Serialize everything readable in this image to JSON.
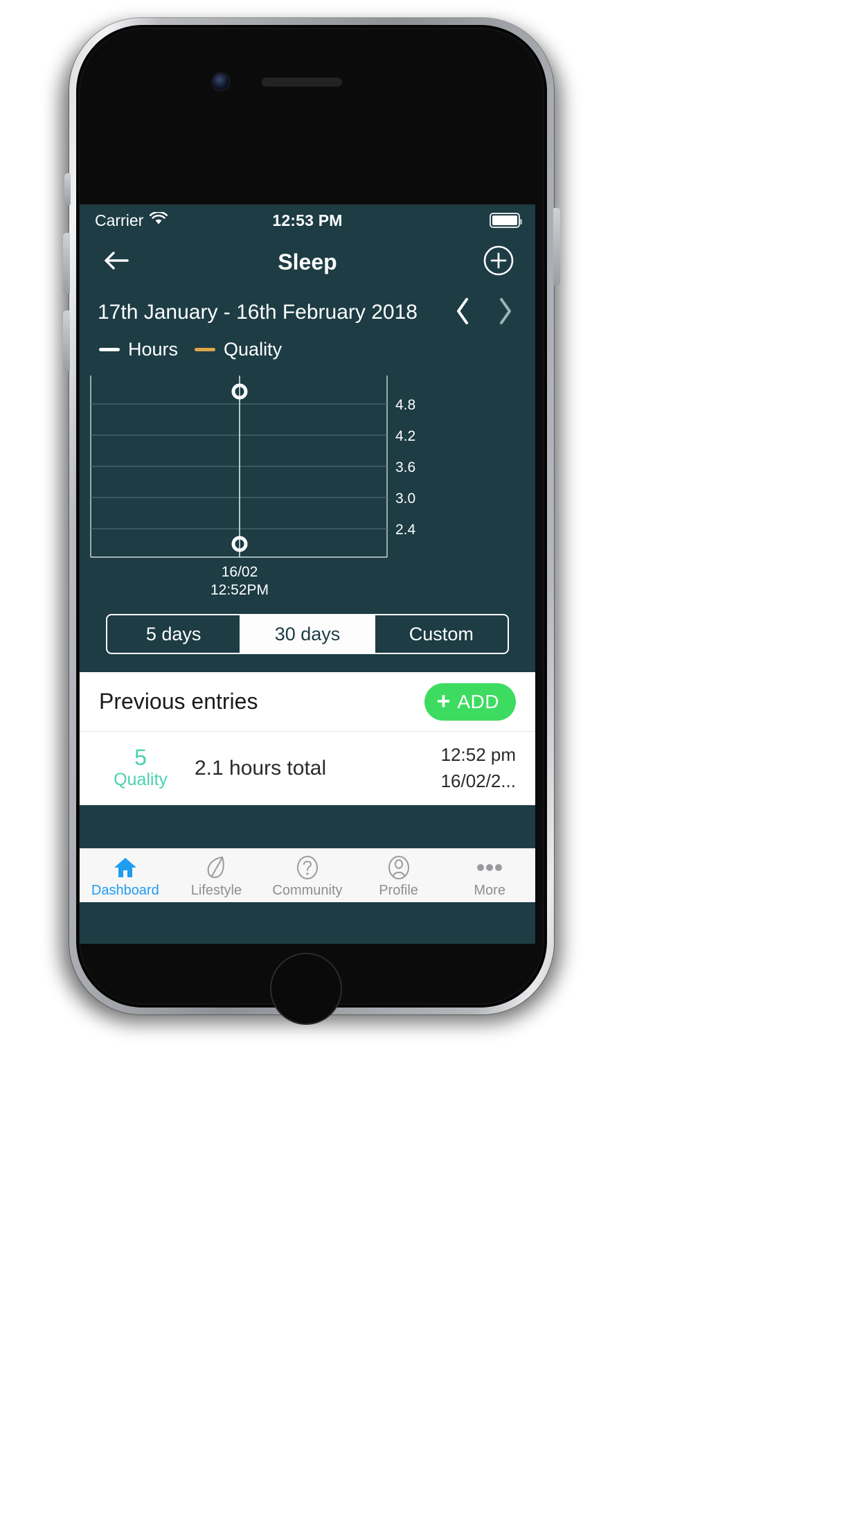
{
  "status_bar": {
    "carrier": "Carrier",
    "wifi_icon": "wifi-icon",
    "time": "12:53 PM",
    "battery_icon": "battery-full-icon"
  },
  "nav": {
    "back_icon": "arrow-left-icon",
    "title": "Sleep",
    "add_icon": "plus-circle-icon"
  },
  "date_range": {
    "label": "17th January - 16th February 2018",
    "prev_icon": "chevron-left-icon",
    "next_icon": "chevron-right-icon"
  },
  "legend": [
    {
      "label": "Hours",
      "color": "#ffffff"
    },
    {
      "label": "Quality",
      "color": "#e0a64a"
    }
  ],
  "chart_data": {
    "type": "line",
    "title": "",
    "xlabel": "",
    "ylabel": "",
    "grid": true,
    "legend_position": "top-left",
    "yticks": [
      "4.8",
      "4.2",
      "3.6",
      "3.0",
      "2.4"
    ],
    "ytick_values": [
      4.8,
      4.2,
      3.6,
      3.0,
      2.4
    ],
    "ylim": [
      1.8,
      5.4
    ],
    "x": [
      "16/02 12:52PM"
    ],
    "xtick_labels": [
      [
        "16/02",
        "12:52PM"
      ]
    ],
    "series": [
      {
        "name": "Hours",
        "color": "#ffffff",
        "values": [
          5.0
        ],
        "marker": "open-circle"
      },
      {
        "name": "Quality",
        "color": "#ffffff",
        "values": [
          2.1
        ],
        "marker": "open-circle"
      }
    ]
  },
  "range_selector": {
    "options": [
      "5 days",
      "30 days",
      "Custom"
    ],
    "selected": "30 days"
  },
  "previous_entries": {
    "title": "Previous entries",
    "add_button": {
      "label": "ADD",
      "plus": "+",
      "color": "#3ddc61"
    },
    "rows": [
      {
        "quality_value": "5",
        "quality_label": "Quality",
        "summary": "2.1 hours total",
        "time": "12:52 pm",
        "date": "16/02/2..."
      }
    ]
  },
  "tabbar": {
    "items": [
      {
        "label": "Dashboard",
        "icon": "home-icon",
        "active": true
      },
      {
        "label": "Lifestyle",
        "icon": "leaf-icon",
        "active": false
      },
      {
        "label": "Community",
        "icon": "question-circle-icon",
        "active": false
      },
      {
        "label": "Profile",
        "icon": "person-circle-icon",
        "active": false
      },
      {
        "label": "More",
        "icon": "ellipsis-icon",
        "active": false
      }
    ]
  },
  "colors": {
    "screen_bg": "#1d3c44",
    "accent_green": "#3ddc61",
    "quality_teal": "#4bd1b0",
    "tab_active": "#1e9cf0",
    "quality_series": "#e0a64a"
  }
}
